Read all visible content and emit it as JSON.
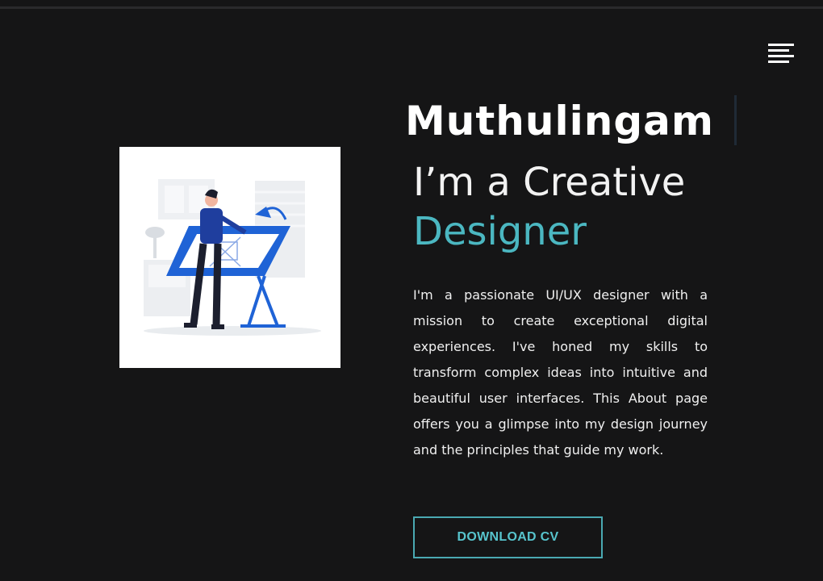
{
  "header": {
    "menu_icon": "hamburger-menu-icon"
  },
  "hero": {
    "name": "Muthulingam",
    "title_line1": "I’m a Creative",
    "title_line2": "Designer",
    "description": "I'm a passionate UI/UX designer with a mission to create exceptional digital experiences. I've honed my skills to transform complex ideas into intuitive and beautiful user interfaces. This About page offers you a glimpse into my design journey and the principles that guide my work.",
    "cta_label": "DOWNLOAD CV",
    "illustration": "designer-at-drafting-table-illustration"
  },
  "colors": {
    "background": "#151516",
    "accent": "#4bb7c1",
    "text": "#ffffff",
    "card": "#ffffff"
  }
}
